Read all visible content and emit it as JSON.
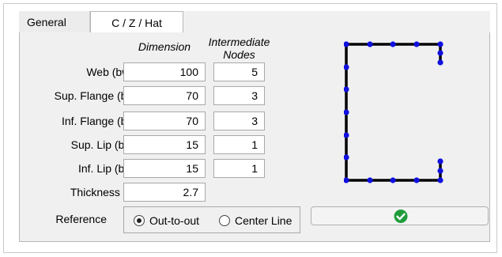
{
  "tabs": [
    {
      "label": "General"
    },
    {
      "label": "C / Z / Hat"
    }
  ],
  "headers": {
    "dimension": "Dimension",
    "intermediate_nodes": "Intermediate\nNodes"
  },
  "rows": [
    {
      "label": "Web (bw)",
      "dimension": "100",
      "nodes": "5"
    },
    {
      "label": "Sup. Flange (bf)",
      "dimension": "70",
      "nodes": "3"
    },
    {
      "label": "Inf. Flange (bf)",
      "dimension": "70",
      "nodes": "3"
    },
    {
      "label": "Sup. Lip (bs)",
      "dimension": "15",
      "nodes": "1"
    },
    {
      "label": "Inf. Lip (bs)",
      "dimension": "15",
      "nodes": "1"
    },
    {
      "label": "Thickness (t)",
      "dimension": "2.7"
    }
  ],
  "reference": {
    "label": "Reference",
    "options": [
      {
        "label": "Out-to-out",
        "selected": true
      },
      {
        "label": "Center Line",
        "selected": false
      }
    ]
  },
  "confirm_button": {
    "icon": "check-circle-icon",
    "color": "#1f9d3b"
  },
  "preview": {
    "line_color": "#000000",
    "node_color": "#1010e0"
  }
}
